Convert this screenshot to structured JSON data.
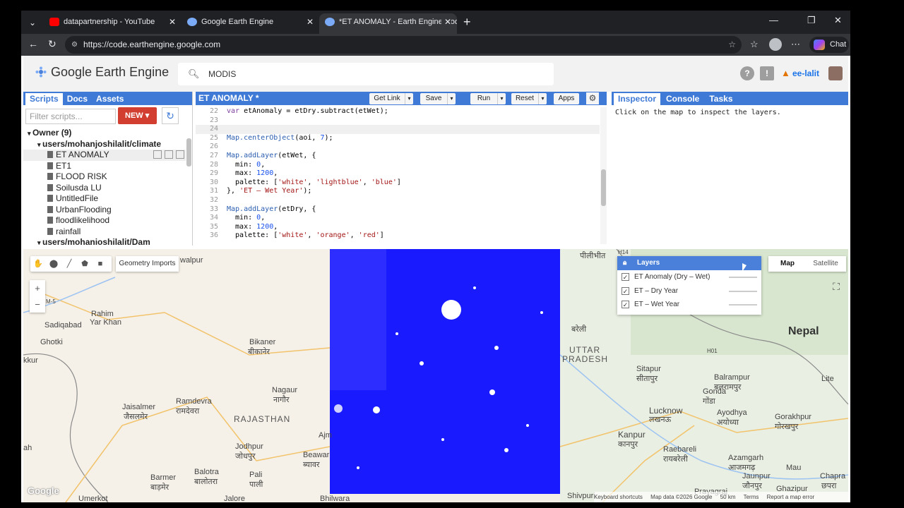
{
  "browser": {
    "tabs": [
      {
        "title": "datapartnership - YouTube",
        "active": false
      },
      {
        "title": "Google Earth Engine",
        "active": false
      },
      {
        "title": "*ET ANOMALY - Earth Engine Code",
        "active": true
      }
    ],
    "url": "https://code.earthengine.google.com",
    "chat_label": "Chat"
  },
  "header": {
    "app_title": "Google Earth Engine",
    "search_value": "MODIS",
    "account": "ee-lalit"
  },
  "left_panel": {
    "tabs": [
      "Scripts",
      "Docs",
      "Assets"
    ],
    "filter_placeholder": "Filter scripts...",
    "new_button": "NEW",
    "tree": [
      {
        "label": "Owner (9)",
        "level": 0,
        "type": "group"
      },
      {
        "label": "users/mohanjoshilalit/climate",
        "level": 1,
        "type": "repo"
      },
      {
        "label": "ET ANOMALY",
        "level": 2,
        "type": "file",
        "selected": true
      },
      {
        "label": "ET1",
        "level": 2,
        "type": "file"
      },
      {
        "label": "FLOOD RISK",
        "level": 2,
        "type": "file"
      },
      {
        "label": "Soilusda LU",
        "level": 2,
        "type": "file"
      },
      {
        "label": "UntitledFile",
        "level": 2,
        "type": "file"
      },
      {
        "label": "UrbanFlooding",
        "level": 2,
        "type": "file"
      },
      {
        "label": "floodlikelihood",
        "level": 2,
        "type": "file"
      },
      {
        "label": "rainfall",
        "level": 2,
        "type": "file"
      },
      {
        "label": "users/mohanjoshilalit/Dam",
        "level": 1,
        "type": "repo"
      }
    ]
  },
  "editor": {
    "title": "ET ANOMALY *",
    "buttons": [
      "Get Link",
      "Save",
      "Run",
      "Reset",
      "Apps"
    ],
    "lines": [
      {
        "n": "22",
        "text": "var etAnomaly = etDry.subtract(etWet);"
      },
      {
        "n": "23",
        "text": ""
      },
      {
        "n": "24",
        "text": ""
      },
      {
        "n": "25",
        "text": "Map.centerObject(aoi, 7);"
      },
      {
        "n": "26",
        "text": ""
      },
      {
        "n": "27",
        "text": "Map.addLayer(etWet, {"
      },
      {
        "n": "28",
        "text": "  min: 0,"
      },
      {
        "n": "29",
        "text": "  max: 1200,"
      },
      {
        "n": "30",
        "text": "  palette: ['white', 'lightblue', 'blue']"
      },
      {
        "n": "31",
        "text": "}, 'ET – Wet Year');"
      },
      {
        "n": "32",
        "text": ""
      },
      {
        "n": "33",
        "text": "Map.addLayer(etDry, {"
      },
      {
        "n": "34",
        "text": "  min: 0,"
      },
      {
        "n": "35",
        "text": "  max: 1200,"
      },
      {
        "n": "36",
        "text": "  palette: ['white', 'orange', 'red']"
      }
    ]
  },
  "right_panel": {
    "tabs": [
      "Inspector",
      "Console",
      "Tasks"
    ],
    "message": "Click on the map to inspect the layers."
  },
  "map": {
    "geometry_imports": "Geometry Imports",
    "layers_title": "Layers",
    "layers": [
      "ET Anomaly (Dry – Wet)",
      "ET – Dry Year",
      "ET – Wet Year"
    ],
    "map_types": [
      "Map",
      "Satellite"
    ],
    "labels": [
      "walpur",
      "Rahim",
      "Yar Khan",
      "Sadiqabad",
      "Ghotki",
      "kkur",
      "Bikaner",
      "बीकानेर",
      "Ramdevra",
      "रामदेवरा",
      "Jaisalmer",
      "जैसलमेर",
      "Nagaur",
      "नागौर",
      "RAJASTHAN",
      "Jodhpur",
      "जोधपुर",
      "Beawar",
      "ब्यावर",
      "Pali",
      "पाली",
      "Barmer",
      "बाड़मेर",
      "Balotra",
      "बालोतरा",
      "Nepal",
      "UTTAR",
      "PRADESH",
      "Sitapur",
      "सीतापुर",
      "Balrampur",
      "बलरामपुर",
      "Gonda",
      "गोंडा",
      "Lucknow",
      "लखनऊ",
      "Ayodhya",
      "अयोध्या",
      "Gorakhpur",
      "गोरखपुर",
      "Kanpur",
      "कानपुर",
      "Raebareli",
      "रायबरेली",
      "Azamgarh",
      "आजमगढ़",
      "Jaunpur",
      "जौनपुर",
      "Mau",
      "Chapra",
      "छपरा",
      "Ghazipur",
      "बरेली",
      "पीलीभीत",
      "Ajm",
      "M-5",
      "H01",
      "Umerkot",
      "Jalore",
      "Bhilwara",
      "Prayagraj",
      "ah",
      "Shivpuri",
      "Balrampur",
      "Lite",
      "H14"
    ],
    "attribution": [
      "Keyboard shortcuts",
      "Map data ©2026 Google",
      "50 km",
      "Terms",
      "Report a map error"
    ]
  },
  "colors": {
    "panel_blue": "#3f7ad6",
    "new_red": "#d23f31",
    "overlay_blue": "#1a1aff"
  }
}
